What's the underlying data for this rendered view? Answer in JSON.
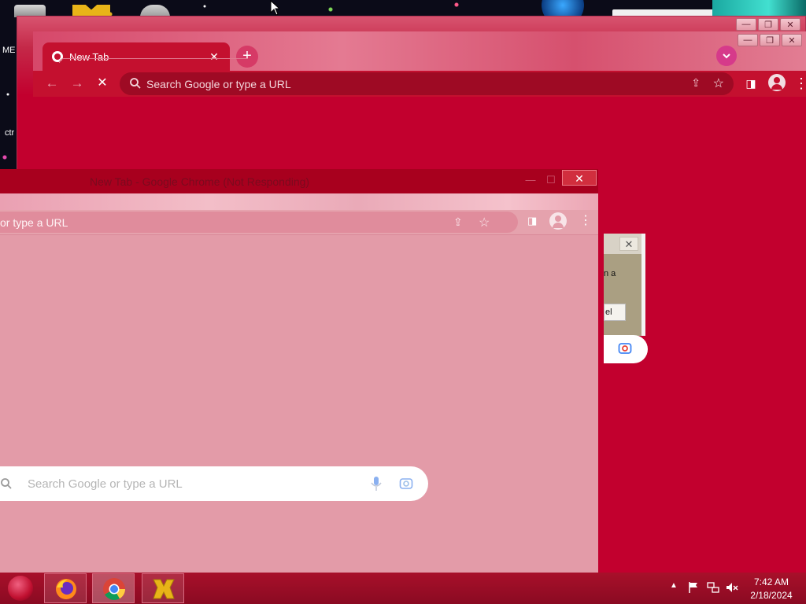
{
  "desktop": {
    "label_me": "ME",
    "label_ctr": "ctr"
  },
  "back_window": {
    "caption_buttons": [
      "—",
      "❐",
      "✕"
    ]
  },
  "chrome": {
    "tab_title": "New Tab",
    "tab_close": "✕",
    "new_tab": "+",
    "omnibox_placeholder": "Search Google or type a URL"
  },
  "not_responding_window": {
    "title": "New Tab - Google Chrome (Not Responding)",
    "close": "✕",
    "omnibox_text": "or type a URL",
    "search_placeholder": "Search Google or type a URL"
  },
  "dialog": {
    "close": "✕",
    "message_fragment": "n a",
    "button_fragment": "el"
  },
  "taskbar": {
    "apps": [
      "firefox",
      "chrome",
      "yellow-app"
    ],
    "time": "7:42 AM",
    "date": "2/18/2024"
  },
  "colors": {
    "theme_red": "#c2002e",
    "not_responding_pink": "#e39ba8",
    "taskbar": "#a8102a"
  }
}
